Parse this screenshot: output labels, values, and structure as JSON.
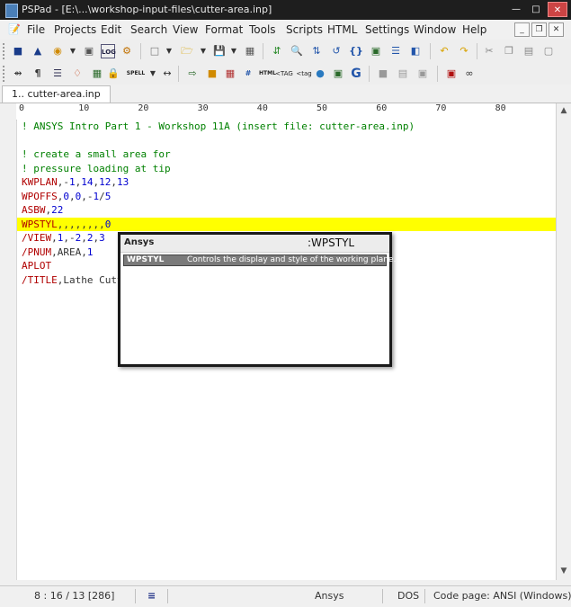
{
  "window": {
    "title": "PSPad - [E:\\...\\workshop-input-files\\cutter-area.inp]"
  },
  "menu": [
    "File",
    "Projects",
    "Edit",
    "Search",
    "View",
    "Format",
    "Tools",
    "Scripts",
    "HTML",
    "Settings",
    "Window",
    "Help"
  ],
  "toolbar1": {
    "log_label": "LOG"
  },
  "toolbar2": {
    "spell_label": "SPELL",
    "html_label": "HTML",
    "tag1_label": "<TAG",
    "tag2_label": "<tag"
  },
  "tabs": [
    {
      "label": "1.. cutter-area.inp"
    }
  ],
  "ruler": [
    "0",
    "10",
    "20",
    "30",
    "40",
    "50",
    "60",
    "70",
    "80"
  ],
  "code_colors": {
    "comment": "#008000",
    "command": "#b00000",
    "number": "#0000d0",
    "text": "#333333",
    "highlight": "#ffff00"
  },
  "code": [
    {
      "t": "! ANSYS Intro Part 1 - Workshop 11A (insert file: cutter-area.inp)",
      "k": "comment"
    },
    {
      "t": "",
      "k": "text"
    },
    {
      "t": "! create a small area for",
      "k": "comment"
    },
    {
      "t": "! pressure loading at tip",
      "k": "comment"
    },
    {
      "t": "KWPLAN,-1,14,12,13",
      "k": "cmd"
    },
    {
      "t": "WPOFFS,0,0,-1/5",
      "k": "cmd"
    },
    {
      "t": "ASBW,22",
      "k": "cmd"
    },
    {
      "t": "WPSTYL,,,,,,,,0",
      "k": "cmd",
      "hl": true
    },
    {
      "t": "/VIEW,1,-2,2,3",
      "k": "cmd"
    },
    {
      "t": "/PNUM,AREA,1",
      "k": "cmd"
    },
    {
      "t": "APLOT",
      "k": "cmd"
    },
    {
      "t": "/TITLE,Lathe Cutter Geometry: Workshop 11A complete",
      "k": "cmd"
    }
  ],
  "popup": {
    "language": "Ansys",
    "command": ":WPSTYL",
    "item_keyword": "WPSTYL",
    "item_desc": "Controls the display and style of the working plane."
  },
  "status": {
    "position": "8 : 16 / 13  [286]",
    "language": "Ansys",
    "eol": "DOS",
    "codepage": "Code page: ANSI (Windows)"
  }
}
